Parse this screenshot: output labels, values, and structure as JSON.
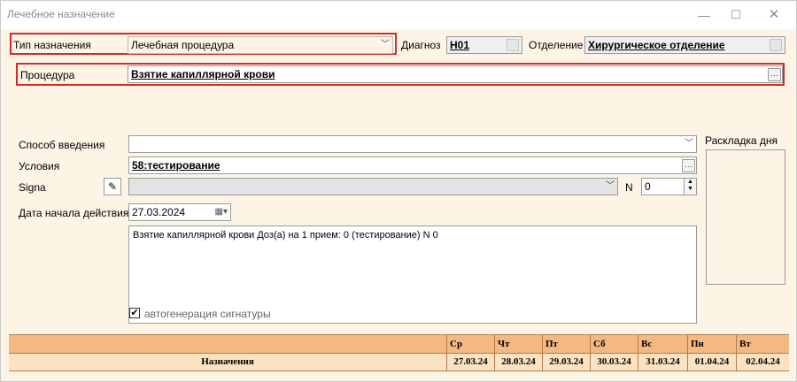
{
  "window": {
    "title": "Лечебное назначение"
  },
  "header": {
    "type_label": "Тип назначения",
    "type_value": "Лечебная процедура",
    "diagnosis_label": "Диагноз",
    "diagnosis_value": "H01",
    "department_label": "Отделение",
    "department_value": "Хирургическое отделение"
  },
  "procedure": {
    "label": "Процедура",
    "value": "Взятие капиллярной крови"
  },
  "form": {
    "route_label": "Способ введения",
    "route_value": "",
    "conditions_label": "Условия",
    "conditions_value": "58:тестирование",
    "signa_label": "Signa",
    "signa_value": "",
    "n_label": "N",
    "n_value": "0",
    "start_date_label": "Дата начала действия",
    "start_date_value": "27.03.2024",
    "signature_text": "Взятие капиллярной крови Доз(а) на 1 прием: 0  (тестирование)  N 0",
    "autogen_label": "автогенерация сигнатуры",
    "day_layout_label": "Раскладка дня"
  },
  "grid": {
    "row_label": "Назначения",
    "days": [
      "Ср",
      "Чт",
      "Пт",
      "Сб",
      "Вс",
      "Пн",
      "Вт"
    ],
    "dates": [
      "27.03.24",
      "28.03.24",
      "29.03.24",
      "30.03.24",
      "31.03.24",
      "01.04.24",
      "02.04.24"
    ]
  },
  "colors": {
    "accent_red": "#d62b2b",
    "panel_bg": "#fdf4e6",
    "grid_header": "#f5b880",
    "grid_row": "#fbe2c0"
  },
  "icons": [
    "minimize-icon",
    "maximize-icon",
    "close-icon",
    "chevron-down-icon",
    "ellipsis-icon",
    "pencil-icon",
    "calendar-icon",
    "checkmark-icon"
  ]
}
